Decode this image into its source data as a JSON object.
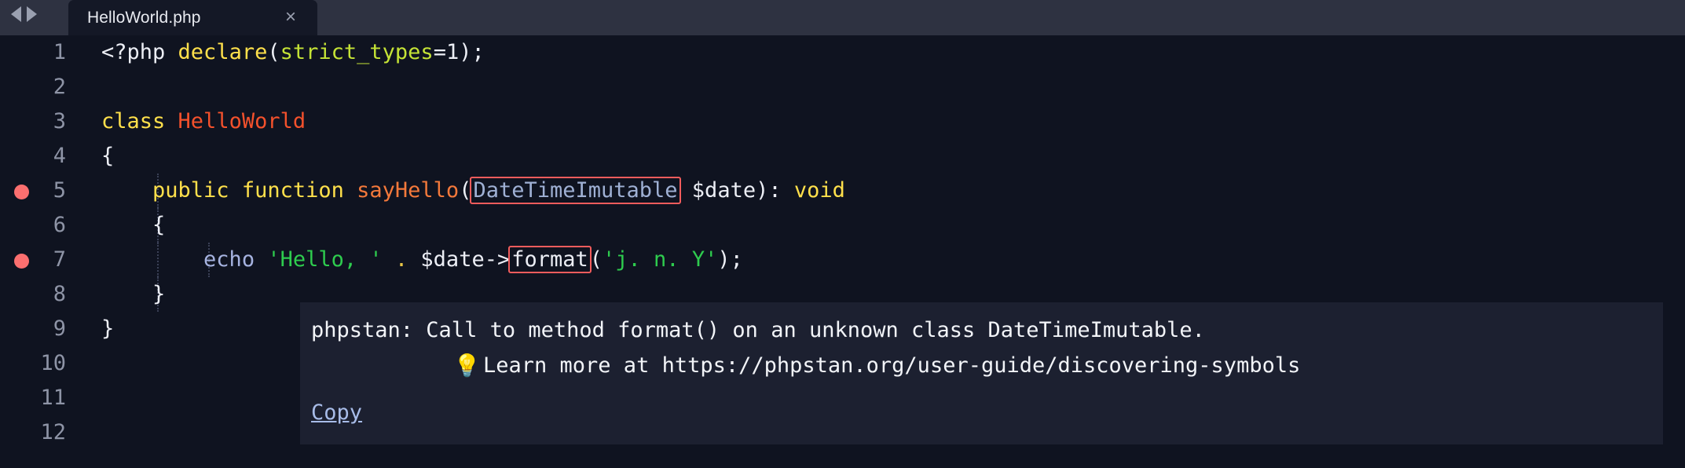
{
  "window": {
    "tabbar": {
      "nav_back_icon": "triangle-left-icon",
      "nav_forward_icon": "triangle-right-icon",
      "active_tab": {
        "label": "HelloWorld.php",
        "close_label": "×"
      }
    }
  },
  "editor": {
    "language": "php",
    "theme_colors": {
      "background": "#0f1320",
      "tabbar_background": "#2e3241",
      "active_tab_background": "#141826",
      "line_number": "#8e94a6",
      "breakpoint": "#fb6f6f",
      "error_underline": "#f25c5c",
      "keyword": "#ffe04b",
      "class_name": "#f4512c",
      "function_name": "#f4793b",
      "string": "#2ecc4e",
      "constant": "#c5e336",
      "tooltip_background": "#1c2030",
      "link": "#a8bce8"
    },
    "lines": [
      {
        "n": "1",
        "breakpoint": false
      },
      {
        "n": "2",
        "breakpoint": false
      },
      {
        "n": "3",
        "breakpoint": false
      },
      {
        "n": "4",
        "breakpoint": false
      },
      {
        "n": "5",
        "breakpoint": true
      },
      {
        "n": "6",
        "breakpoint": false
      },
      {
        "n": "7",
        "breakpoint": true
      },
      {
        "n": "8",
        "breakpoint": false
      },
      {
        "n": "9",
        "breakpoint": false
      },
      {
        "n": "10",
        "breakpoint": false
      },
      {
        "n": "11",
        "breakpoint": false
      },
      {
        "n": "12",
        "breakpoint": false
      }
    ],
    "code": {
      "l1": {
        "open_tag": "<?php ",
        "declare": "declare",
        "paren_open": "(",
        "strict_types": "strict_types",
        "eq_one": "=1",
        "tail": ");"
      },
      "l3": {
        "class_kw": "class ",
        "class_name": "HelloWorld"
      },
      "l4": {
        "brace": "{"
      },
      "l5": {
        "visibility": "public ",
        "function_kw": "function ",
        "name": "sayHello",
        "paren_open": "(",
        "type_hint": "DateTimeImutable",
        "param": " $date",
        "tail": "): ",
        "return_type": "void"
      },
      "l6": {
        "brace": "{"
      },
      "l7": {
        "echo_kw": "echo ",
        "string1": "'Hello, '",
        "concat": " . ",
        "var": "$date->",
        "method": "format",
        "paren_open": "(",
        "string2": "'j. n. Y'",
        "tail": ");"
      },
      "l8": {
        "brace": "}"
      },
      "l9": {
        "brace": "}"
      }
    }
  },
  "tooltip": {
    "line1": "phpstan: Call to method format() on an unknown class DateTimeImutable.",
    "bulb_icon": "💡",
    "line2": "Learn more at https://phpstan.org/user-guide/discovering-symbols",
    "copy_label": "Copy"
  }
}
